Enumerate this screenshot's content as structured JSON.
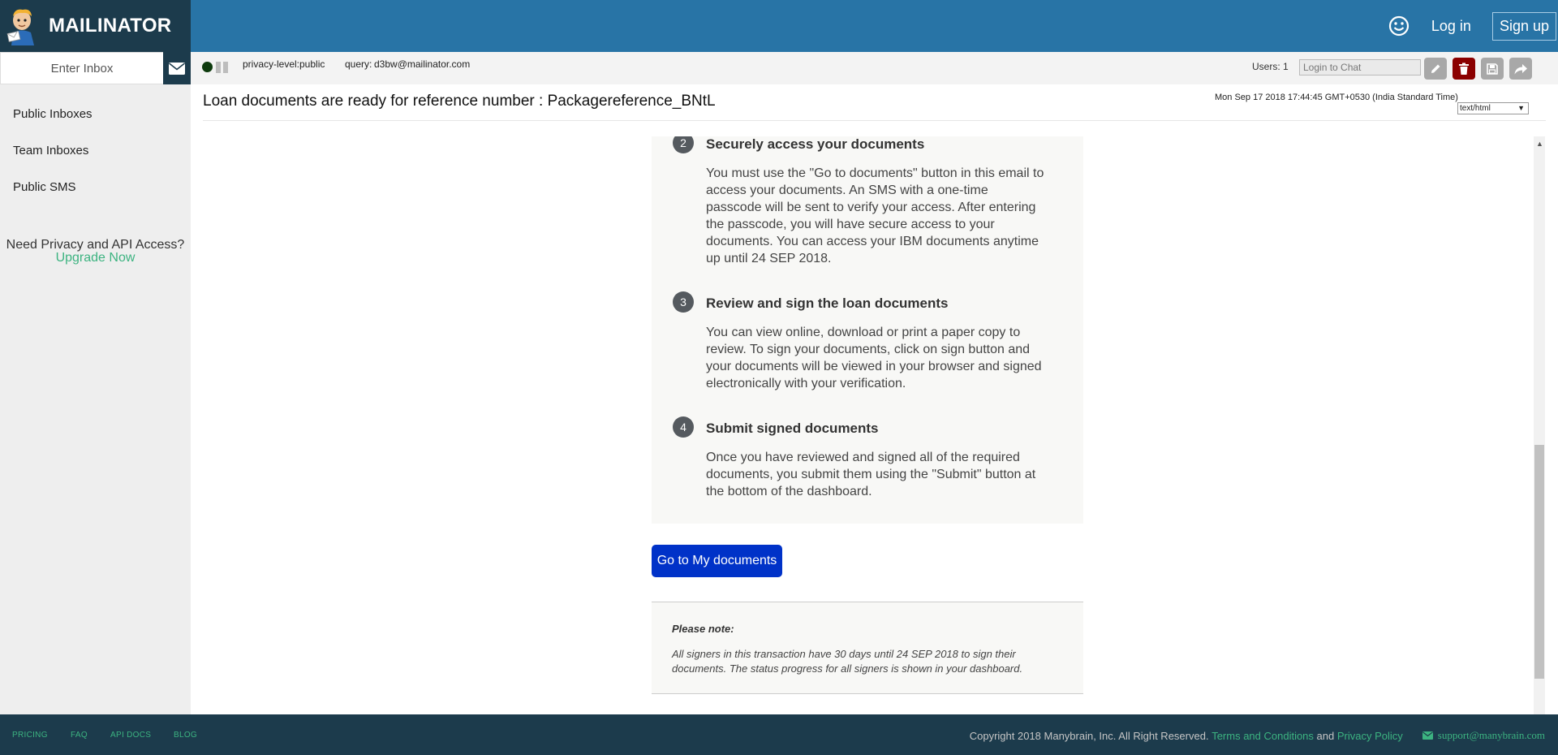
{
  "brand": {
    "name": "MAILINATOR"
  },
  "header": {
    "login_label": "Log in",
    "signup_label": "Sign up"
  },
  "sidebar": {
    "inbox_placeholder": "Enter Inbox",
    "links": [
      "Public Inboxes",
      "Team Inboxes",
      "Public SMS"
    ],
    "promo_text": "Need Privacy and API Access?",
    "promo_link": "Upgrade Now"
  },
  "toolbar": {
    "privacy_label": "privacy-level:",
    "privacy_value": "public",
    "query_label": "query:",
    "query_value": "d3bw@mailinator.com",
    "users_label": "Users: 1",
    "chat_placeholder": "Login to Chat"
  },
  "message": {
    "subject": "Loan documents are ready for reference number : Packagereference_BNtL",
    "date": "Mon Sep 17 2018 17:44:45 GMT+0530 (India Standard Time)",
    "format": "text/html",
    "steps": [
      {
        "num": "2",
        "title": "Securely access your documents",
        "lines": [
          "You must use the \"Go to documents\" button in this email to",
          "access your documents. An SMS with a one-time",
          "passcode will be sent to verify your access. After entering",
          "the passcode, you will have secure access to your",
          "documents. You can access your IBM documents anytime",
          "up until 24 SEP 2018."
        ]
      },
      {
        "num": "3",
        "title": "Review and sign the loan documents",
        "lines": [
          "You can view online, download or print a paper copy to",
          "review. To sign your documents, click on sign button and",
          "your documents will be viewed in your browser and signed",
          "electronically with your verification."
        ]
      },
      {
        "num": "4",
        "title": "Submit signed documents",
        "lines": [
          "Once you have reviewed and signed all of the required",
          "documents, you submit them using the \"Submit\" button at",
          "the bottom of the dashboard."
        ]
      }
    ],
    "button_label": "Go to My documents",
    "note_title": "Please note:",
    "note_lines": [
      "All signers in this transaction have 30 days until 24 SEP 2018 to sign their",
      "documents. The status progress for all signers is shown in your dashboard."
    ]
  },
  "footer": {
    "links": [
      "PRICING",
      "FAQ",
      "API DOCS",
      "BLOG"
    ],
    "copyright": "Copyright 2018 Manybrain, Inc. All Right Reserved.",
    "terms": "Terms and Conditions",
    "and": "and",
    "privacy": "Privacy Policy",
    "support": "support@manybrain.com"
  },
  "colors": {
    "topbar": "#2874a6",
    "brand_bg": "#1c3b4c",
    "accent_green": "#3cb380",
    "primary_button": "#0032c8",
    "delete_button": "#8b0000"
  },
  "icons": [
    "mailinator-logo-icon",
    "smiley-icon",
    "envelope-icon",
    "pause-icon",
    "pencil-icon",
    "trash-icon",
    "save-icon",
    "share-icon",
    "mail-icon"
  ]
}
